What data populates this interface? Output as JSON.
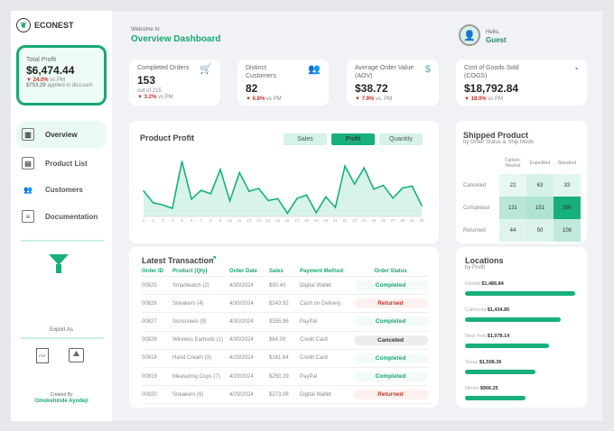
{
  "brand": "ECONEST",
  "total_profit": {
    "label": "Total Profit",
    "value": "$6,474.44",
    "change": "▼ 24.0%",
    "change_suffix": "vs PM",
    "discount": "$753.29",
    "discount_suffix": "applied in discount"
  },
  "nav": [
    {
      "label": "Overview",
      "icon": "overview-icon",
      "active": true
    },
    {
      "label": "Product List",
      "icon": "clipboard-icon"
    },
    {
      "label": "Customers",
      "icon": "users-icon"
    },
    {
      "label": "Documentation",
      "icon": "document-icon"
    }
  ],
  "export": {
    "label": "Export As"
  },
  "credit": {
    "label": "Created By",
    "name": "Omokehinde Ayodeji"
  },
  "header": {
    "welcome": "Welcome to",
    "title": "Overview Dashboard",
    "hello": "Hello,",
    "user": "Guest"
  },
  "kpis": [
    {
      "label": "Completed Orders",
      "value": "153",
      "sub": "out of 215",
      "change": "▼ 3.2%",
      "suffix": "vs PM",
      "icon": "cart-icon"
    },
    {
      "label": "Distinct Customers",
      "value": "82",
      "change": "▼ 6.8%",
      "suffix": "vs PM",
      "icon": "users-icon"
    },
    {
      "label": "Average Order Value (AOV)",
      "value": "$38.72",
      "change": "▼ 7.9%",
      "suffix": "vs. PM",
      "icon": "money-hand-icon"
    },
    {
      "label": "Cost of Goods Sold (COGS)",
      "value": "$18,792.84",
      "change": "▼ 18.0%",
      "suffix": "vs PM",
      "icon": "pie-chart-icon"
    }
  ],
  "chart_data": {
    "type": "area",
    "title": "Product Profit",
    "tabs": [
      "Sales",
      "Profit",
      "Quantity"
    ],
    "active_tab": "Profit",
    "x": [
      1,
      2,
      3,
      4,
      5,
      6,
      7,
      8,
      9,
      10,
      11,
      12,
      13,
      14,
      15,
      16,
      17,
      18,
      19,
      20,
      21,
      22,
      23,
      24,
      25,
      26,
      27,
      28,
      29,
      30
    ],
    "values": [
      82,
      44,
      37,
      26,
      177,
      56,
      84,
      73,
      151,
      50,
      141,
      81,
      90,
      51,
      57,
      10,
      58,
      69,
      12,
      63,
      29,
      162,
      104,
      156,
      88,
      100,
      59,
      91,
      98,
      35
    ],
    "color": "#18b07a"
  },
  "shipped": {
    "title": "Shipped Product",
    "subtitle": "by Order Status & Ship Mode",
    "cols": [
      "Carbon-Neutral",
      "Expedited",
      "Standard"
    ],
    "rows": [
      {
        "label": "Canceled",
        "values": [
          22,
          63,
          33
        ]
      },
      {
        "label": "Completed",
        "values": [
          131,
          151,
          390
        ]
      },
      {
        "label": "Returned",
        "values": [
          44,
          50,
          108
        ]
      }
    ]
  },
  "transactions": {
    "title": "Latest Transaction",
    "headers": [
      "Order ID",
      "Product (Qty)",
      "Order Date",
      "Sales",
      "Payment Method",
      "Order Status"
    ],
    "rows": [
      [
        "00825",
        "Smartwatch (2)",
        "4/30/2024",
        "$90.40",
        "Digital Wallet",
        "Completed"
      ],
      [
        "00826",
        "Sneakers (4)",
        "4/30/2024",
        "$243.92",
        "Cash on Delivery",
        "Returned"
      ],
      [
        "00827",
        "Sunscreen (9)",
        "4/30/2024",
        "$355.86",
        "PayPal",
        "Completed"
      ],
      [
        "00828",
        "Wireless Earbuds (1)",
        "4/30/2024",
        "$64.09",
        "Credit Card",
        "Canceled"
      ],
      [
        "00818",
        "Hand Cream (3)",
        "4/29/2024",
        "$161.64",
        "Credit Card",
        "Completed"
      ],
      [
        "00819",
        "Measuring Cups (7)",
        "4/29/2024",
        "$250.39",
        "PayPal",
        "Completed"
      ],
      [
        "00820",
        "Sneakers (6)",
        "4/29/2024",
        "$273.06",
        "Digital Wallet",
        "Returned"
      ]
    ]
  },
  "locations": {
    "title": "Locations",
    "subtitle": "by Profit",
    "items": [
      {
        "name": "Florida",
        "value": "$1,486.84",
        "pct": 100
      },
      {
        "name": "California",
        "value": "$1,434.85",
        "pct": 87
      },
      {
        "name": "New York",
        "value": "$1,078.14",
        "pct": 76
      },
      {
        "name": "Texas",
        "value": "$1,508.36",
        "pct": 64
      },
      {
        "name": "Illinois",
        "value": "$966.25",
        "pct": 55
      }
    ]
  }
}
